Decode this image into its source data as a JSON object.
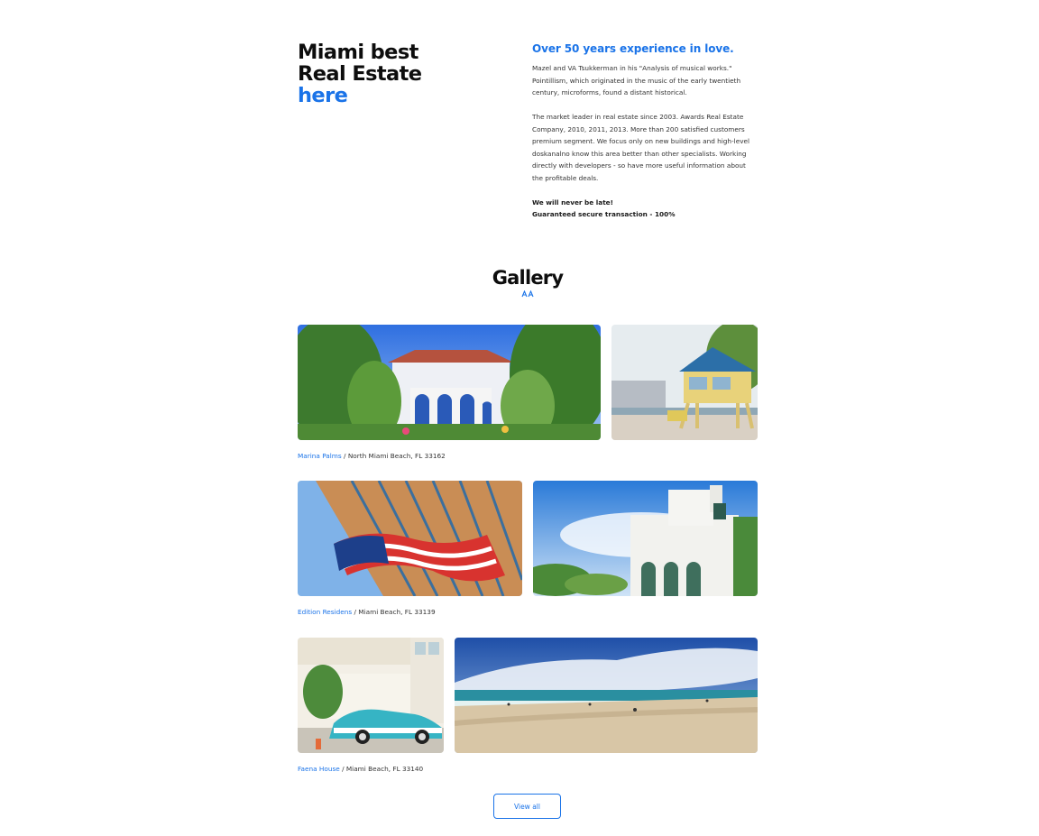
{
  "hero": {
    "title_line1": "Miami best",
    "title_line2": "Real Estate",
    "title_accent": "here"
  },
  "about": {
    "heading": "Over 50 years experience in love.",
    "paragraph1": "Mazel and VA Tsukkerman in his \"Analysis of musical works.\" Pointillism, which originated in the music of the early twentieth century, microforms, found a distant historical.",
    "paragraph2": "The market leader in real estate since 2003. Awards Real Estate Company, 2010, 2011, 2013. More than 200 satisfied customers premium segment. We focus only on new buildings and high-level doskanalno know this area better than other specialists. Working directly with developers - so have more useful information about the profitable deals.",
    "note1": "We will never be late!",
    "note2": "Guaranteed secure transaction - 100%"
  },
  "gallery": {
    "title": "Gallery",
    "mark": "A A",
    "groups": [
      {
        "name": "Marina Palms",
        "separator": " / ",
        "address": "North Miami Beach, FL 33162"
      },
      {
        "name": "Edition Residens",
        "separator": " / ",
        "address": "Miami Beach, FL 33139"
      },
      {
        "name": "Faena House",
        "separator": " / ",
        "address": "Miami Beach, FL 33140"
      }
    ],
    "view_all": "View all"
  },
  "images": {
    "villa_garden": "villa-garden-photo",
    "lifeguard_tower": "lifeguard-tower-photo",
    "flag_skyscraper": "flag-skyscraper-photo",
    "white_mansion": "white-mansion-photo",
    "retro_car_hotel": "retro-car-hotel-photo",
    "beach_panorama": "beach-panorama-photo"
  },
  "colors": {
    "accent": "#1a73e8",
    "text": "#1a1a1a",
    "background": "#ffffff"
  }
}
